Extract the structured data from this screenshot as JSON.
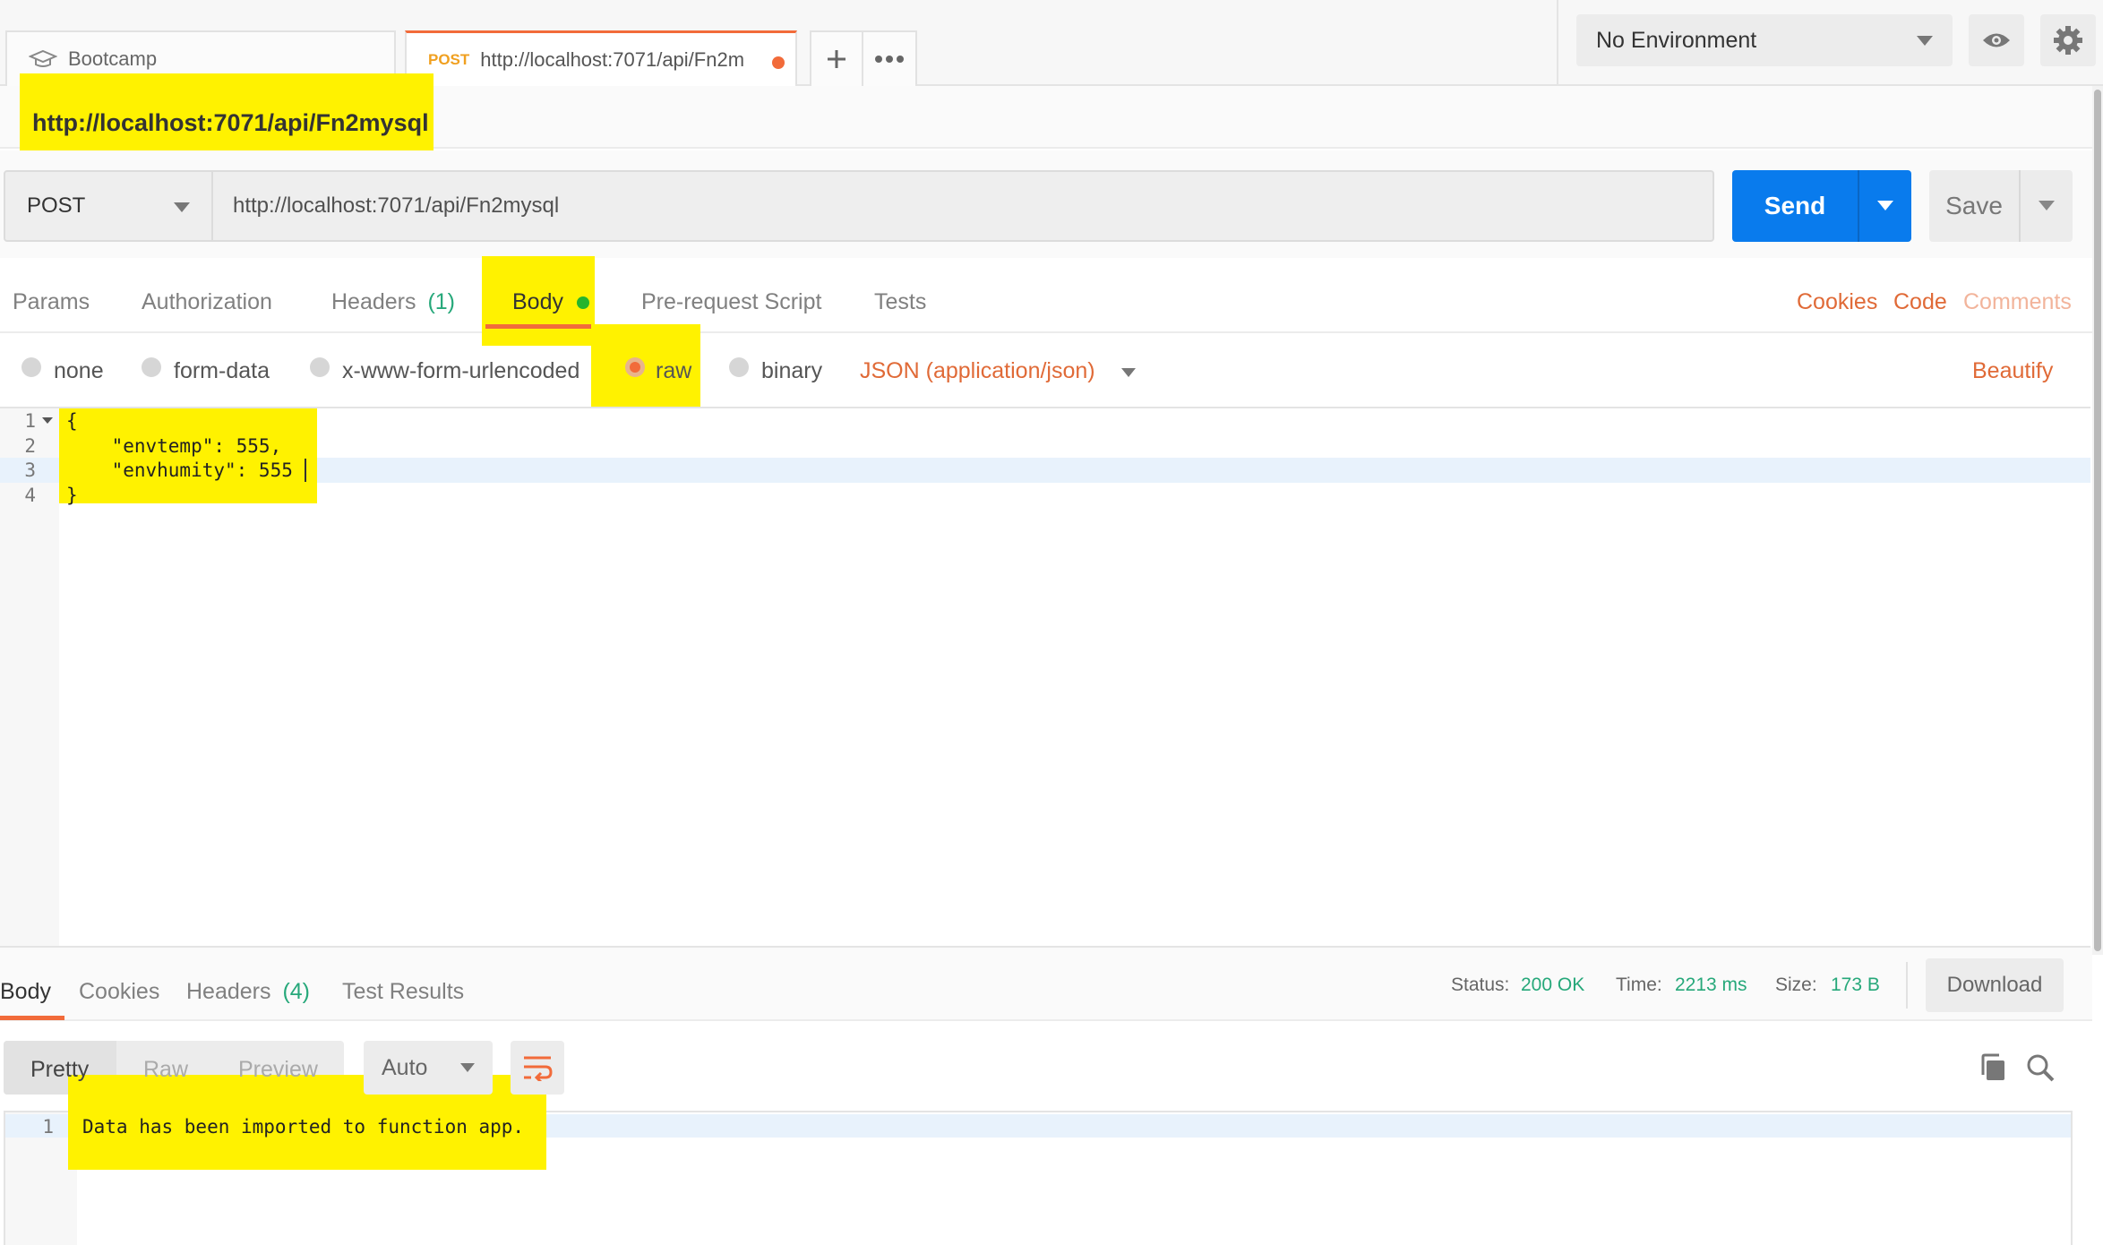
{
  "tabs": {
    "collection_tab": "Bootcamp",
    "request_tab_method": "POST",
    "request_tab_url": "http://localhost:7071/api/Fn2m"
  },
  "environment": {
    "selected": "No Environment"
  },
  "request": {
    "name": "http://localhost:7071/api/Fn2mysql",
    "method": "POST",
    "url": "http://localhost:7071/api/Fn2mysql",
    "send_label": "Send",
    "save_label": "Save"
  },
  "request_tabs": {
    "params": "Params",
    "authorization": "Authorization",
    "headers": "Headers",
    "headers_count": "(1)",
    "body": "Body",
    "prerequest": "Pre-request Script",
    "tests": "Tests",
    "cookies": "Cookies",
    "code": "Code",
    "comments": "Comments"
  },
  "body_modes": {
    "none": "none",
    "form_data": "form-data",
    "urlencoded": "x-www-form-urlencoded",
    "raw": "raw",
    "binary": "binary",
    "content_type": "JSON (application/json)",
    "beautify": "Beautify",
    "selected": "raw"
  },
  "request_body": {
    "line_numbers": [
      "1",
      "2",
      "3",
      "4"
    ],
    "lines": [
      "{",
      "    \"envtemp\": 555,",
      "    \"envhumity\": 555",
      "}"
    ]
  },
  "response": {
    "tabs": {
      "body": "Body",
      "cookies": "Cookies",
      "headers": "Headers",
      "headers_count": "(4)",
      "test_results": "Test Results"
    },
    "status_label": "Status:",
    "status_value": "200 OK",
    "time_label": "Time:",
    "time_value": "2213 ms",
    "size_label": "Size:",
    "size_value": "173 B",
    "download_label": "Download",
    "views": {
      "pretty": "Pretty",
      "raw": "Raw",
      "preview": "Preview",
      "format": "Auto"
    },
    "body_line_number": "1",
    "body_text": "Data has been imported to function app."
  },
  "colors": {
    "accent_orange": "#f26b3a",
    "send_blue": "#097bed",
    "status_green": "#26a87a",
    "highlight_yellow": "#fff200"
  }
}
